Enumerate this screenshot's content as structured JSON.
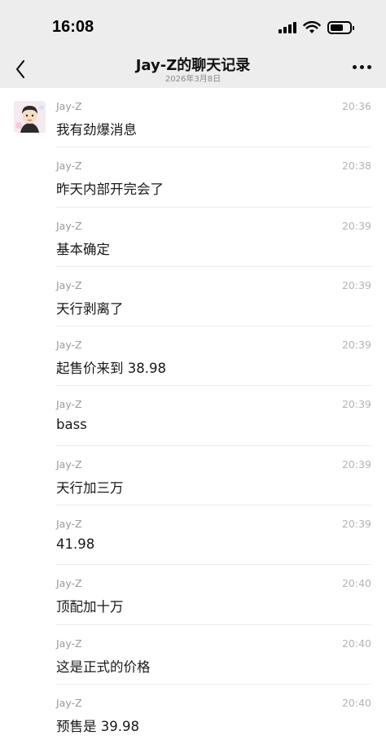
{
  "status_bar": {
    "time": "16:08"
  },
  "header": {
    "title": "Jay-Z的聊天记录",
    "subtitle": "2026年3月8日"
  },
  "messages": [
    {
      "sender": "Jay-Z",
      "time": "20:36",
      "text": "我有劲爆消息",
      "show_avatar": true
    },
    {
      "sender": "Jay-Z",
      "time": "20:38",
      "text": "昨天内部开完会了"
    },
    {
      "sender": "Jay-Z",
      "time": "20:39",
      "text": "基本确定"
    },
    {
      "sender": "Jay-Z",
      "time": "20:39",
      "text": "天行剥离了"
    },
    {
      "sender": "Jay-Z",
      "time": "20:39",
      "text": "起售价来到 38.98"
    },
    {
      "sender": "Jay-Z",
      "time": "20:39",
      "text": "bass"
    },
    {
      "sender": "Jay-Z",
      "time": "20:39",
      "text": "天行加三万"
    },
    {
      "sender": "Jay-Z",
      "time": "20:39",
      "text": "41.98"
    },
    {
      "sender": "Jay-Z",
      "time": "20:40",
      "text": "顶配加十万"
    },
    {
      "sender": "Jay-Z",
      "time": "20:40",
      "text": "这是正式的价格"
    },
    {
      "sender": "Jay-Z",
      "time": "20:40",
      "text": "预售是 39.98"
    }
  ]
}
